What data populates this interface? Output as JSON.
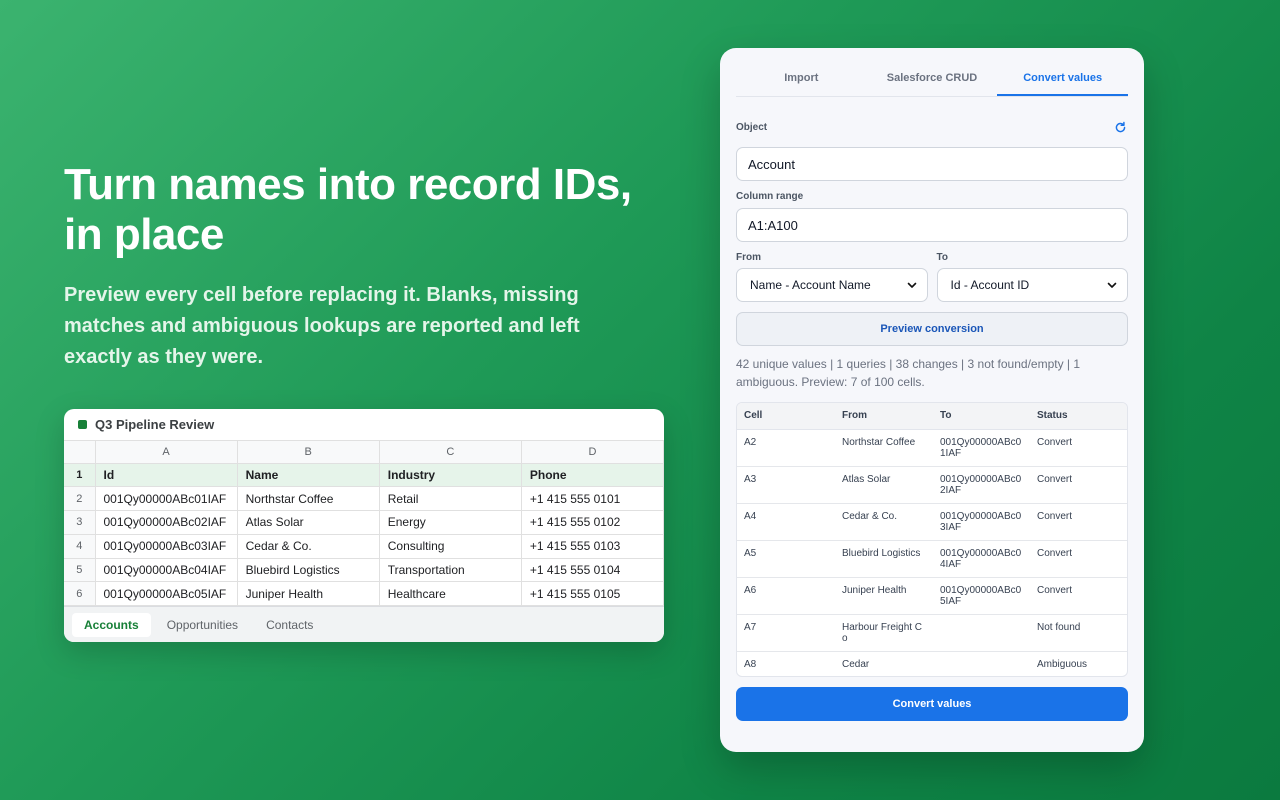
{
  "hero": {
    "title": "Turn names into record IDs, in place",
    "subtitle": "Preview every cell before replacing it. Blanks, missing matches and ambiguous lookups are reported and left exactly as they were."
  },
  "sheet": {
    "title": "Q3 Pipeline Review",
    "columns": [
      "A",
      "B",
      "C",
      "D"
    ],
    "rows": [
      {
        "num": "1",
        "cells": [
          "Id",
          "Name",
          "Industry",
          "Phone"
        ]
      },
      {
        "num": "2",
        "cells": [
          "001Qy00000ABc01IAF",
          "Northstar Coffee",
          "Retail",
          "+1 415 555 0101"
        ]
      },
      {
        "num": "3",
        "cells": [
          "001Qy00000ABc02IAF",
          "Atlas Solar",
          "Energy",
          "+1 415 555 0102"
        ]
      },
      {
        "num": "4",
        "cells": [
          "001Qy00000ABc03IAF",
          "Cedar & Co.",
          "Consulting",
          "+1 415 555 0103"
        ]
      },
      {
        "num": "5",
        "cells": [
          "001Qy00000ABc04IAF",
          "Bluebird Logistics",
          "Transportation",
          "+1 415 555 0104"
        ]
      },
      {
        "num": "6",
        "cells": [
          "001Qy00000ABc05IAF",
          "Juniper Health",
          "Healthcare",
          "+1 415 555 0105"
        ]
      }
    ],
    "tabs": [
      "Accounts",
      "Opportunities",
      "Contacts"
    ],
    "active_tab": "Accounts"
  },
  "panel": {
    "tabs": [
      "Import",
      "Salesforce CRUD",
      "Convert values"
    ],
    "active_tab": "Convert values",
    "object_label": "Object",
    "object_value": "Account",
    "range_label": "Column range",
    "range_value": "A1:A100",
    "from_label": "From",
    "from_value": "Name - Account Name",
    "to_label": "To",
    "to_value": "Id - Account ID",
    "preview_button": "Preview conversion",
    "summary": "42 unique values | 1 queries | 38 changes | 3 not found/empty | 1 ambiguous. Preview: 7 of 100 cells.",
    "results_headers": [
      "Cell",
      "From",
      "To",
      "Status"
    ],
    "results": [
      [
        "A2",
        "Northstar Coffee",
        "001Qy00000ABc01IAF",
        "Convert"
      ],
      [
        "A3",
        "Atlas Solar",
        "001Qy00000ABc02IAF",
        "Convert"
      ],
      [
        "A4",
        "Cedar & Co.",
        "001Qy00000ABc03IAF",
        "Convert"
      ],
      [
        "A5",
        "Bluebird Logistics",
        "001Qy00000ABc04IAF",
        "Convert"
      ],
      [
        "A6",
        "Juniper Health",
        "001Qy00000ABc05IAF",
        "Convert"
      ],
      [
        "A7",
        "Harbour Freight Co",
        "",
        "Not found"
      ],
      [
        "A8",
        "Cedar",
        "",
        "Ambiguous"
      ]
    ],
    "convert_button": "Convert values",
    "accent_color": "#1a73e8",
    "icons": {
      "refresh": "refresh-icon",
      "chevron": "chevron-down-icon"
    }
  }
}
